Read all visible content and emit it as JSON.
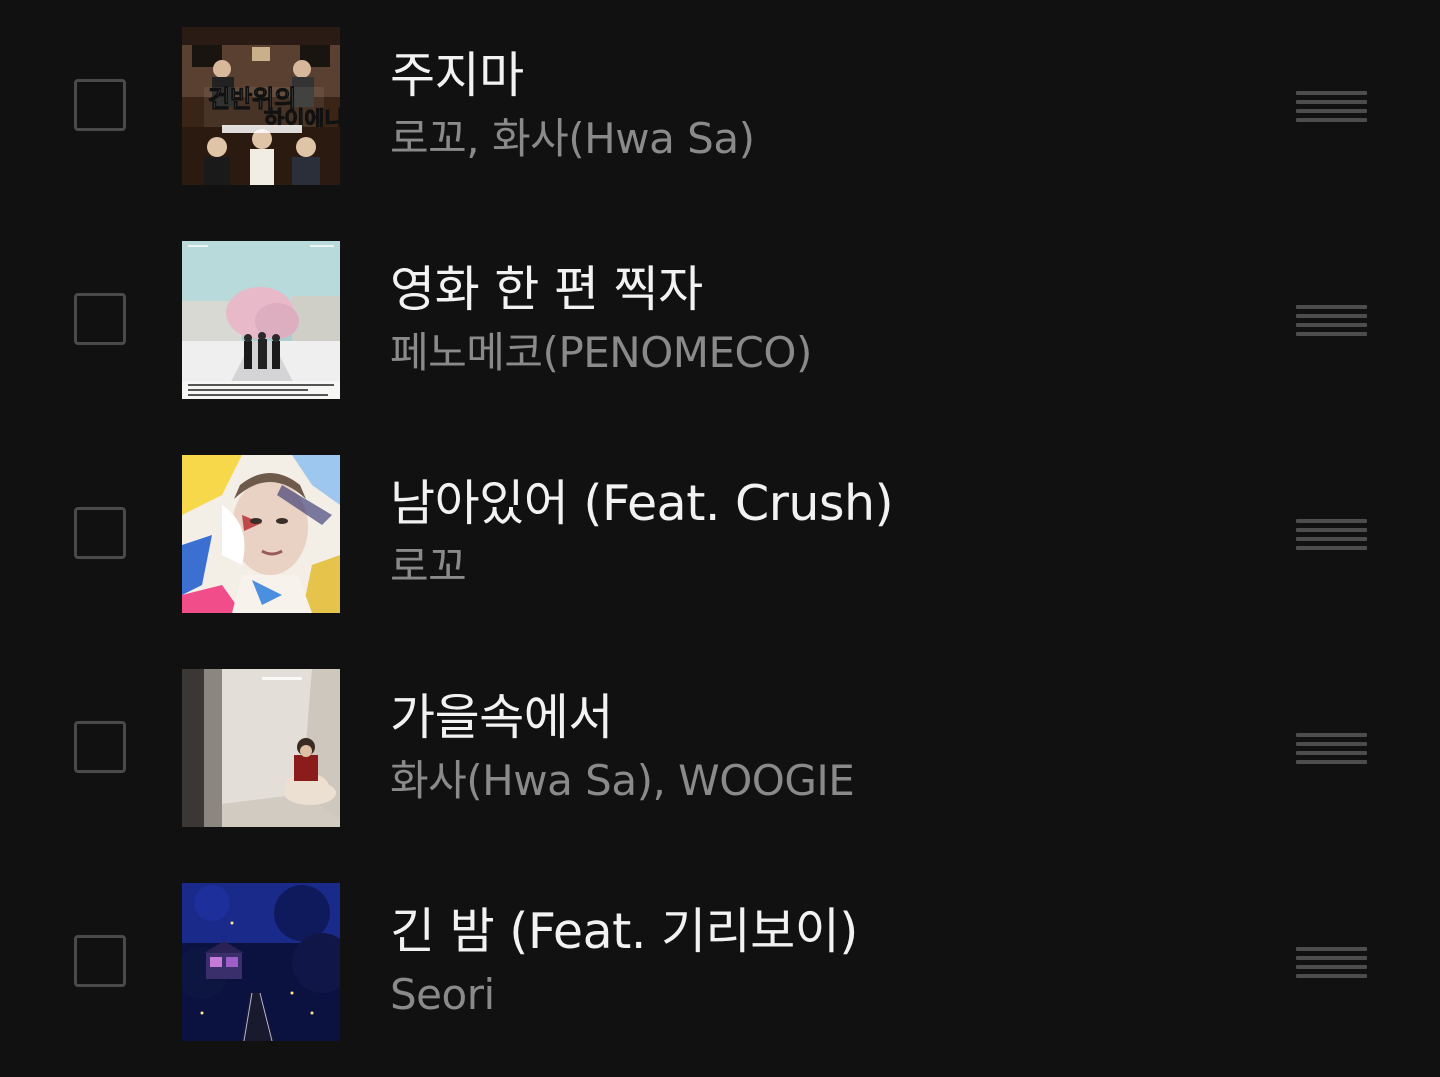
{
  "tracks": [
    {
      "title": "주지마",
      "artist": "로꼬, 화사(Hwa Sa)",
      "art_icon": "album-art-live-band",
      "checked": false
    },
    {
      "title": "영화 한 편 찍자",
      "artist": "페노메코(PENOMECO)",
      "art_icon": "album-art-cherry-blossom-street",
      "checked": false
    },
    {
      "title": "남아있어 (Feat. Crush)",
      "artist": "로꼬",
      "art_icon": "album-art-painted-portrait",
      "checked": false
    },
    {
      "title": "가을속에서",
      "artist": "화사(Hwa Sa), WOOGIE",
      "art_icon": "album-art-woman-in-corner",
      "checked": false
    },
    {
      "title": "긴 밤 (Feat. 기리보이)",
      "artist": "Seori",
      "art_icon": "album-art-night-treehouse",
      "checked": false
    }
  ],
  "colors": {
    "background": "#111112",
    "title": "#f2f2f2",
    "artist": "#8a8a8a",
    "control": "#4d4d4d"
  }
}
